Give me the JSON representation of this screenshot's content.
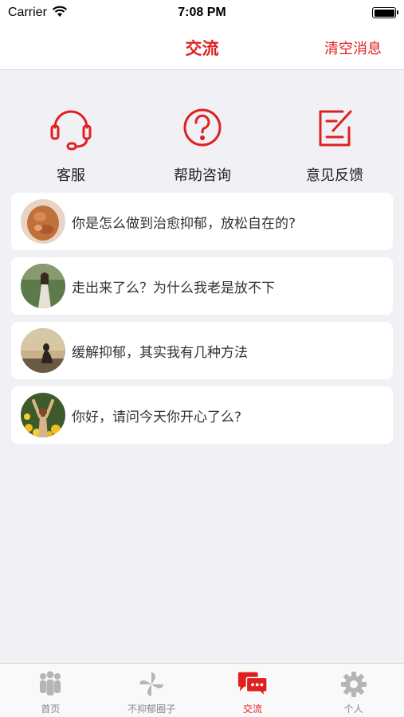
{
  "status_bar": {
    "carrier": "Carrier",
    "time": "7:08 PM"
  },
  "nav": {
    "title": "交流",
    "right_action": "清空消息"
  },
  "quick_actions": [
    {
      "label": "客服",
      "icon": "headset-icon"
    },
    {
      "label": "帮助咨询",
      "icon": "question-circle-icon"
    },
    {
      "label": "意见反馈",
      "icon": "edit-note-icon"
    }
  ],
  "messages": [
    {
      "text": "你是怎么做到治愈抑郁，放松自在的?",
      "avatar": "avatar-bread"
    },
    {
      "text": "走出来了么？为什么我老是放不下",
      "avatar": "avatar-girl-forest"
    },
    {
      "text": "缓解抑郁，其实我有几种方法",
      "avatar": "avatar-sunset-silhouette"
    },
    {
      "text": "你好，请问今天你开心了么?",
      "avatar": "avatar-flowers-arms"
    }
  ],
  "tabs": [
    {
      "label": "首页",
      "icon": "people-icon",
      "active": false
    },
    {
      "label": "不抑郁圈子",
      "icon": "pinwheel-icon",
      "active": false
    },
    {
      "label": "交流",
      "icon": "chat-bubbles-icon",
      "active": true
    },
    {
      "label": "个人",
      "icon": "gear-icon",
      "active": false
    }
  ],
  "colors": {
    "accent": "#e02020",
    "inactive": "#b5b5b5",
    "background": "#f1f1f5"
  }
}
